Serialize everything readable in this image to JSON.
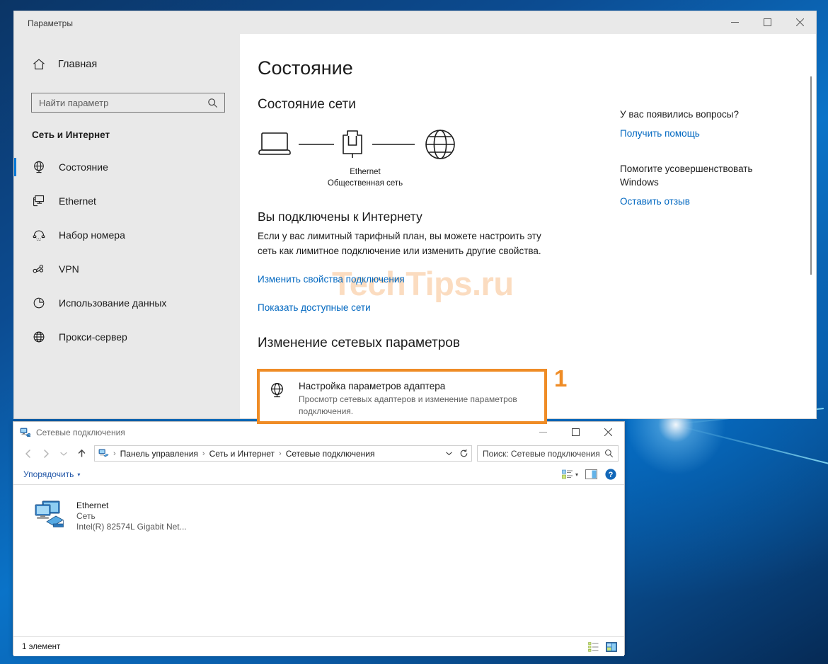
{
  "settings": {
    "title": "Параметры",
    "window_controls": {
      "minimize": "—",
      "maximize": "□",
      "close": "✕"
    },
    "nav": {
      "home_label": "Главная",
      "search_placeholder": "Найти параметр",
      "search_value": "",
      "category": "Сеть и Интернет",
      "items": [
        {
          "label": "Состояние",
          "icon": "globe-status-icon",
          "selected": true
        },
        {
          "label": "Ethernet",
          "icon": "ethernet-icon",
          "selected": false
        },
        {
          "label": "Набор номера",
          "icon": "dialup-icon",
          "selected": false
        },
        {
          "label": "VPN",
          "icon": "vpn-icon",
          "selected": false
        },
        {
          "label": "Использование данных",
          "icon": "data-usage-icon",
          "selected": false
        },
        {
          "label": "Прокси-сервер",
          "icon": "proxy-icon",
          "selected": false
        }
      ]
    },
    "main": {
      "page_title": "Состояние",
      "section_title": "Состояние сети",
      "diagram": {
        "device_icon": "laptop-icon",
        "adapter_icon": "ethernet-port-icon",
        "internet_icon": "globe-icon",
        "network_name": "Ethernet",
        "network_type": "Общественная сеть"
      },
      "status_heading": "Вы подключены к Интернету",
      "status_description": "Если у вас лимитный тарифный план, вы можете настроить эту сеть как лимитное подключение или изменить другие свойства.",
      "link_change_properties": "Изменить свойства подключения",
      "link_show_networks": "Показать доступные сети",
      "change_heading": "Изменение сетевых параметров",
      "adapter_option": {
        "title": "Настройка параметров адаптера",
        "subtitle": "Просмотр сетевых адаптеров и изменение параметров подключения.",
        "icon": "adapter-globe-icon",
        "highlight_color": "#ef8c26"
      },
      "step_marker": "1",
      "watermark": "TechTips.ru"
    },
    "help": {
      "blocks": [
        {
          "heading": "У вас появились вопросы?",
          "link": "Получить помощь"
        },
        {
          "heading": "Помогите усовершенствовать Windows",
          "link": "Оставить отзыв"
        }
      ]
    }
  },
  "explorer": {
    "title": "Сетевые подключения",
    "title_icon": "network-connections-icon",
    "window_controls": {
      "minimize": "—",
      "maximize": "□",
      "close": "✕"
    },
    "nav_buttons": {
      "back": "back-arrow-icon",
      "forward": "forward-arrow-icon",
      "recent": "chevron-down-icon",
      "up": "up-arrow-icon"
    },
    "breadcrumb": [
      "Панель управления",
      "Сеть и Интернет",
      "Сетевые подключения"
    ],
    "breadcrumb_separator": "›",
    "address_dropdown": "chevron-down-icon",
    "refresh": "refresh-icon",
    "search_placeholder": "Поиск: Сетевые подключения",
    "search_value": "",
    "toolbar": {
      "organize_label": "Упорядочить",
      "organize_caret": "▾",
      "view_options_icon": "view-options-icon",
      "view_caret": "▾",
      "preview_pane_icon": "preview-pane-icon",
      "help_icon": "help-icon"
    },
    "connections": [
      {
        "name": "Ethernet",
        "network": "Сеть",
        "adapter": "Intel(R) 82574L Gigabit Net...",
        "icon": "network-adapter-icon"
      }
    ],
    "statusbar": {
      "count": "1 элемент",
      "details_view_icon": "details-view-icon",
      "tiles-view_icon": "tiles-view-icon"
    }
  }
}
